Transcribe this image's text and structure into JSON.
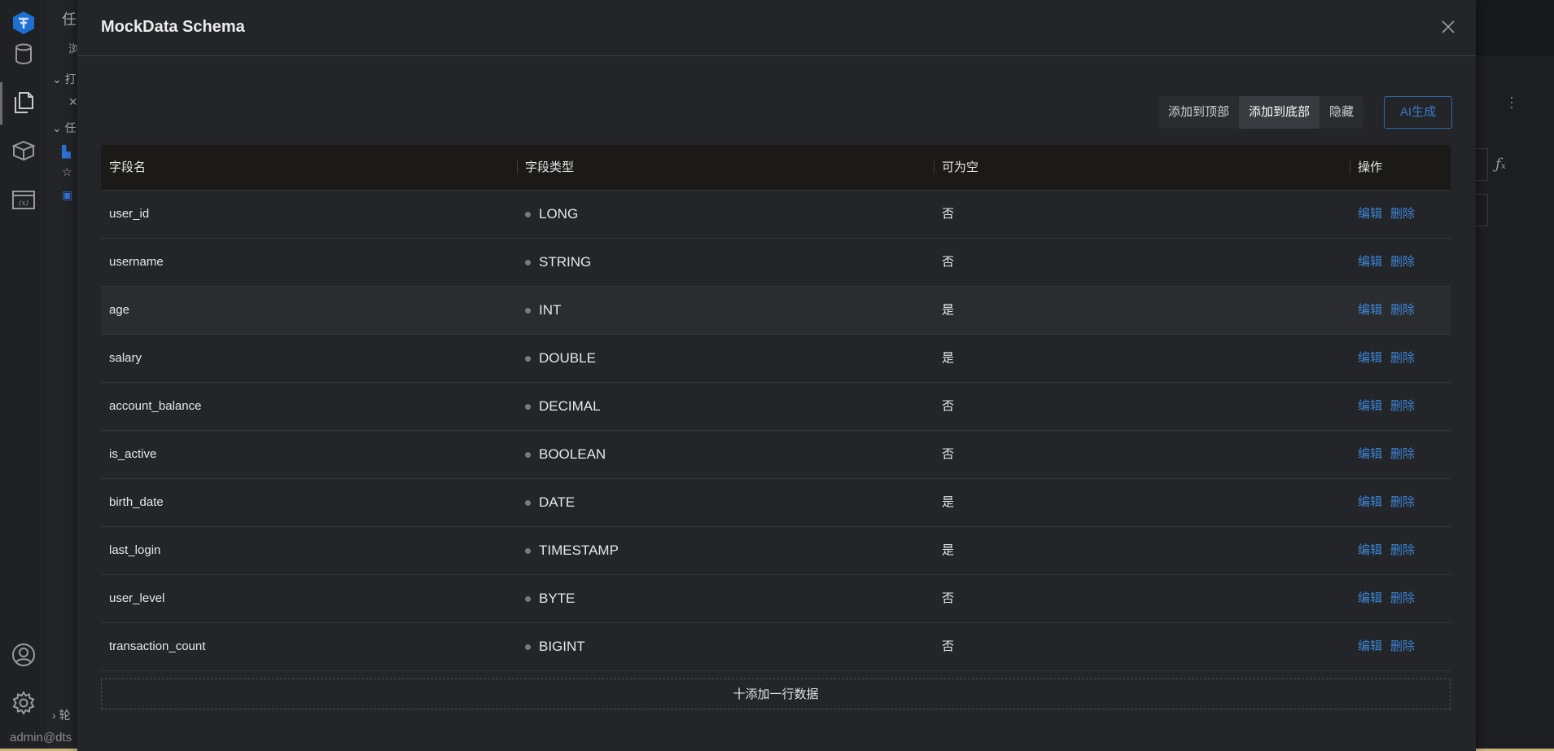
{
  "background": {
    "tab_fragment": "任",
    "sub_fragment": "浏",
    "section_open": "打",
    "section_tasks": "任",
    "section_bottom": "轮",
    "status_user": "admin@dts"
  },
  "modal": {
    "title": "MockData Schema",
    "toolbar": {
      "add_top_label": "添加到顶部",
      "add_bottom_label": "添加到底部",
      "hide_label": "隐藏",
      "ai_label": "AI生成"
    },
    "table": {
      "headers": [
        "字段名",
        "字段类型",
        "可为空",
        "操作"
      ],
      "action_edit": "编辑",
      "action_delete": "删除",
      "rows": [
        {
          "name": "user_id",
          "type": "LONG",
          "nullable": "否"
        },
        {
          "name": "username",
          "type": "STRING",
          "nullable": "否"
        },
        {
          "name": "age",
          "type": "INT",
          "nullable": "是"
        },
        {
          "name": "salary",
          "type": "DOUBLE",
          "nullable": "是"
        },
        {
          "name": "account_balance",
          "type": "DECIMAL",
          "nullable": "否"
        },
        {
          "name": "is_active",
          "type": "BOOLEAN",
          "nullable": "否"
        },
        {
          "name": "birth_date",
          "type": "DATE",
          "nullable": "是"
        },
        {
          "name": "last_login",
          "type": "TIMESTAMP",
          "nullable": "是"
        },
        {
          "name": "user_level",
          "type": "BYTE",
          "nullable": "否"
        },
        {
          "name": "transaction_count",
          "type": "BIGINT",
          "nullable": "否"
        }
      ]
    },
    "add_row_label": "十添加一行数据"
  },
  "colors": {
    "accent": "#3b86d6",
    "modal_bg": "#232529",
    "header_bg": "#1b1a19"
  }
}
